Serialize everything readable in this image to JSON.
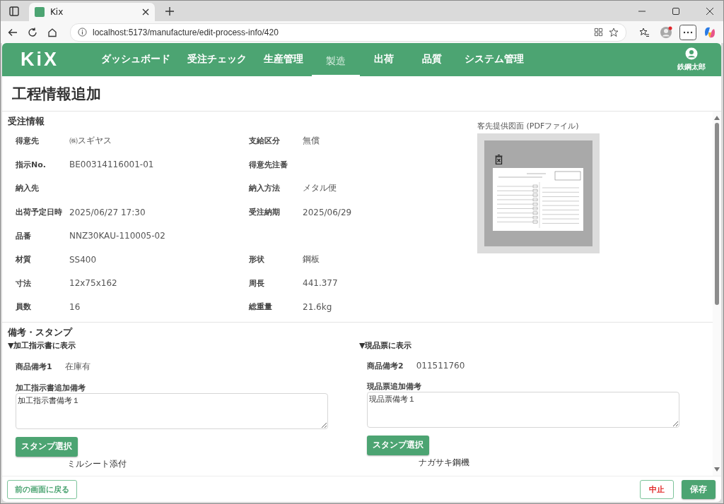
{
  "browser": {
    "tab_title": "Kix",
    "url": "localhost:5173/manufacture/edit-process-info/420"
  },
  "nav": {
    "logo": "KiX",
    "items": [
      {
        "label": "ダッシュボード",
        "selected": false
      },
      {
        "label": "受注チェック",
        "selected": false
      },
      {
        "label": "生産管理",
        "selected": false
      },
      {
        "label": "製造",
        "selected": true
      },
      {
        "label": "出荷",
        "selected": false
      },
      {
        "label": "品質",
        "selected": false
      },
      {
        "label": "システム管理",
        "selected": false
      }
    ],
    "user": "鉄鋼太郎"
  },
  "page_title": "工程情報追加",
  "order_info": {
    "heading": "受注情報",
    "rows": [
      {
        "left": {
          "label": "得意先",
          "value": "㈱スギヤス"
        },
        "right": {
          "label": "支給区分",
          "value": "無償"
        }
      },
      {
        "left": {
          "label": "指示No.",
          "value": "BE00314116001-01"
        },
        "right": {
          "label": "得意先注番"
        }
      },
      {
        "left": {
          "label": "納入先"
        },
        "right": {
          "label": "納入方法",
          "value": "メタル便"
        }
      },
      {
        "left": {
          "label": "出荷予定日時",
          "value": "2025/06/27 17:30"
        },
        "right": {
          "label": "受注納期",
          "value": "2025/06/29"
        }
      },
      {
        "left": {
          "label": "品番",
          "value": "NNZ30KAU-110005-02"
        }
      },
      {
        "left": {
          "label": "材質",
          "value": "SS400"
        },
        "right": {
          "label": "形状",
          "value": "鋼板"
        }
      },
      {
        "left": {
          "label": "寸法",
          "value": "12x75x162"
        },
        "right": {
          "label": "周長",
          "value": "441.377"
        }
      },
      {
        "left": {
          "label": "員数",
          "value": "16"
        },
        "right": {
          "label": "総重量",
          "value": "21.6kg"
        }
      }
    ]
  },
  "drawing": {
    "label": "客先提供図面 (PDFファイル)"
  },
  "remarks": {
    "heading": "備考・スタンプ",
    "sections": [
      {
        "title": "▼加工指示書に表示",
        "note_label": "商品備考1",
        "note_value": "在庫有",
        "extra_label": "加工指示書追加備考",
        "extra_value": "加工指示書備考１",
        "button": "スタンプ選択",
        "stamp": "ミルシート添付"
      },
      {
        "title": "▼現品票に表示",
        "note_label": "商品備考2",
        "note_value": "011511760",
        "extra_label": "現品票追加備考",
        "extra_value": "現品票備考１",
        "button": "スタンプ選択",
        "stamp": "ナガサキ鋼機"
      }
    ]
  },
  "footer": {
    "back": "前の画面に戻る",
    "cancel": "中止",
    "save": "保存"
  }
}
